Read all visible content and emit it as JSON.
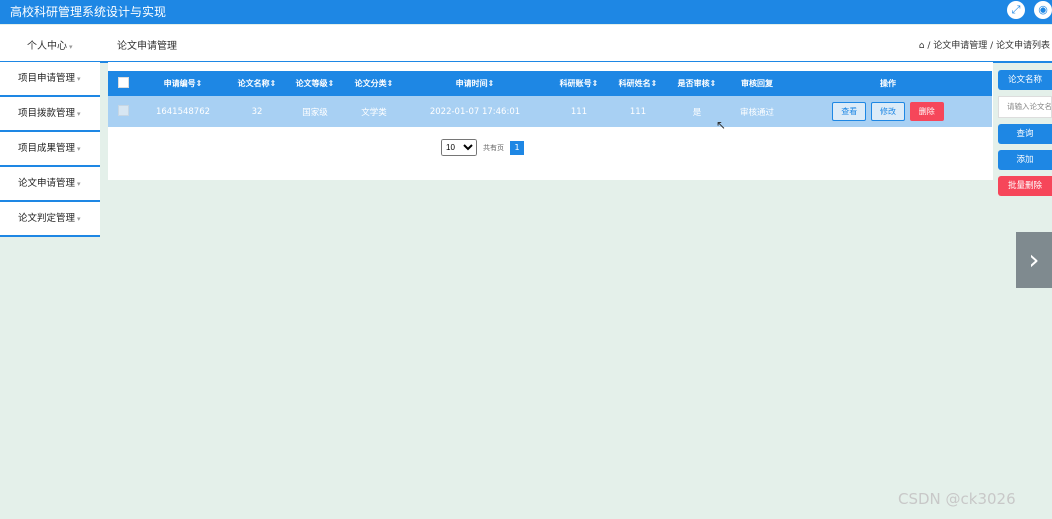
{
  "app": {
    "title": "高校科研管理系统设计与实现"
  },
  "navbar": {
    "personal_center": "个人中心",
    "section_title": "论文申请管理",
    "breadcrumb": "论文申请管理 / 论文申请列表"
  },
  "sidebar": {
    "items": [
      {
        "label": "项目申请管理"
      },
      {
        "label": "项目拨款管理"
      },
      {
        "label": "项目成果管理"
      },
      {
        "label": "论文申请管理"
      },
      {
        "label": "论文判定管理"
      }
    ]
  },
  "table": {
    "headers": [
      "申请编号",
      "论文名称",
      "论文等级",
      "论文分类",
      "申请时间",
      "科研账号",
      "科研姓名",
      "是否审核",
      "审核回复",
      "操作"
    ],
    "rows": [
      {
        "id": "1641548762",
        "name": "32",
        "level": "国家级",
        "category": "文学类",
        "time": "2022-01-07 17:46:01",
        "account": "111",
        "researcher": "111",
        "reviewed": "是",
        "reply": "审核通过"
      }
    ],
    "actions": {
      "view": "查看",
      "edit": "修改",
      "delete": "删除"
    }
  },
  "pagination": {
    "page_size": "10",
    "total_text": "共有页",
    "current_page": "1"
  },
  "search_panel": {
    "label": "论文名称",
    "placeholder": "请输入论文名称",
    "query_button": "查询",
    "add_button": "添加",
    "batch_delete_button": "批量删除"
  },
  "watermark": "CSDN @ck3026",
  "colors": {
    "primary": "#1e87e4",
    "danger": "#f6465a",
    "row_bg": "#a8d0f3",
    "page_bg": "#e4f0ea"
  }
}
